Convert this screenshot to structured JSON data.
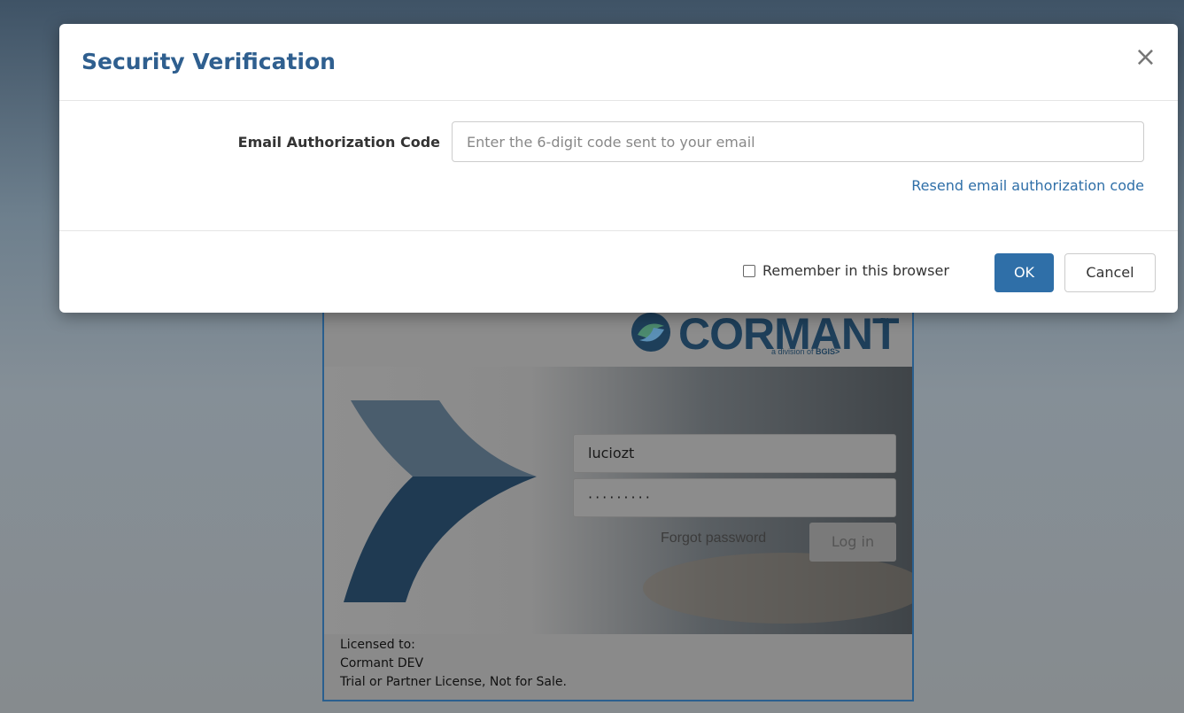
{
  "modal": {
    "title": "Security Verification",
    "close_icon": "close-icon",
    "code_label": "Email Authorization Code",
    "code_placeholder": "Enter the 6-digit code sent to your email",
    "code_value": "",
    "resend_link": "Resend email authorization code",
    "remember_label": "Remember in this browser",
    "remember_checked": false,
    "ok_label": "OK",
    "cancel_label": "Cancel",
    "accent_color": "#2f6fa8"
  },
  "login": {
    "logo_text": "CORMANT",
    "logo_tm": "™",
    "logo_sub_prefix": "a division of ",
    "logo_sub_brand": "BGIS>",
    "username": "luciozt",
    "password_mask": "·········",
    "forgot_password": "Forgot password",
    "login_button": "Log in",
    "license_line1": "Licensed to:",
    "license_line2": "Cormant DEV",
    "license_line3": "Trial or Partner License, Not for Sale."
  }
}
